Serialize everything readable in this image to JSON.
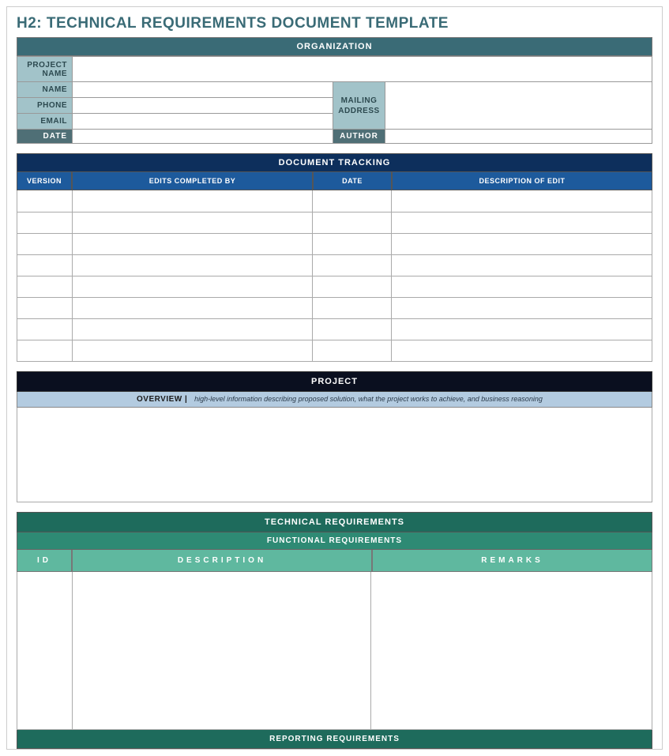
{
  "title": "H2: TECHNICAL REQUIREMENTS DOCUMENT TEMPLATE",
  "organization": {
    "header": "ORGANIZATION",
    "labels": {
      "project_name": "PROJECT NAME",
      "name": "NAME",
      "phone": "PHONE",
      "email": "EMAIL",
      "date": "DATE",
      "mailing_address": "MAILING ADDRESS",
      "author": "AUTHOR"
    },
    "values": {
      "project_name": "",
      "name": "",
      "phone": "",
      "email": "",
      "date": "",
      "mailing_address": "",
      "author": ""
    }
  },
  "tracking": {
    "header": "DOCUMENT TRACKING",
    "columns": {
      "version": "VERSION",
      "edits_by": "EDITS COMPLETED BY",
      "date": "DATE",
      "description": "DESCRIPTION OF EDIT"
    },
    "rows": [
      {
        "version": "",
        "edits_by": "",
        "date": "",
        "description": ""
      },
      {
        "version": "",
        "edits_by": "",
        "date": "",
        "description": ""
      },
      {
        "version": "",
        "edits_by": "",
        "date": "",
        "description": ""
      },
      {
        "version": "",
        "edits_by": "",
        "date": "",
        "description": ""
      },
      {
        "version": "",
        "edits_by": "",
        "date": "",
        "description": ""
      },
      {
        "version": "",
        "edits_by": "",
        "date": "",
        "description": ""
      },
      {
        "version": "",
        "edits_by": "",
        "date": "",
        "description": ""
      },
      {
        "version": "",
        "edits_by": "",
        "date": "",
        "description": ""
      }
    ]
  },
  "project": {
    "header": "PROJECT",
    "overview_label": "OVERVIEW   |",
    "overview_note": "high-level information describing proposed solution, what the project works to achieve, and business reasoning",
    "overview_body": ""
  },
  "technical": {
    "header": "TECHNICAL REQUIREMENTS",
    "functional_header": "FUNCTIONAL REQUIREMENTS",
    "columns": {
      "id": "ID",
      "description": "DESCRIPTION",
      "remarks": "REMARKS"
    },
    "reporting_header": "REPORTING REQUIREMENTS"
  }
}
